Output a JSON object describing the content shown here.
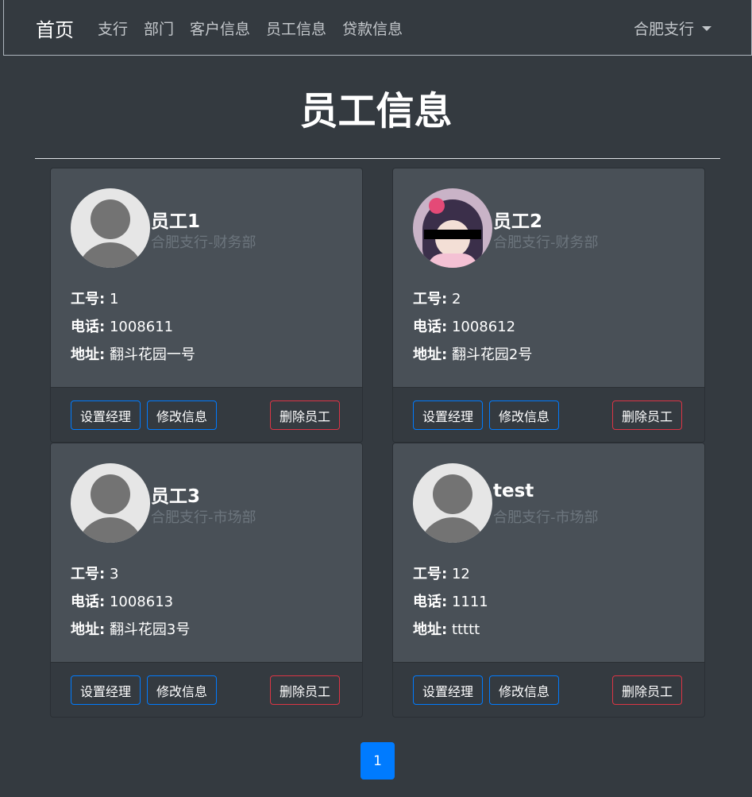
{
  "navbar": {
    "brand": "首页",
    "links": [
      "支行",
      "部门",
      "客户信息",
      "员工信息",
      "贷款信息"
    ],
    "branch_dropdown": "合肥支行"
  },
  "page_title": "员工信息",
  "labels": {
    "id": "工号:",
    "phone": "电话:",
    "address": "地址:"
  },
  "buttons": {
    "set_manager": "设置经理",
    "edit": "修改信息",
    "delete": "删除员工"
  },
  "employees": [
    {
      "name": "员工1",
      "dept": "合肥支行-财务部",
      "id": "1",
      "phone": "1008611",
      "address": "翻斗花园一号",
      "avatar": "default-avatar-icon"
    },
    {
      "name": "员工2",
      "dept": "合肥支行-财务部",
      "id": "2",
      "phone": "1008612",
      "address": "翻斗花园2号",
      "avatar": "anime-avatar-photo"
    },
    {
      "name": "员工3",
      "dept": "合肥支行-市场部",
      "id": "3",
      "phone": "1008613",
      "address": "翻斗花园3号",
      "avatar": "default-avatar-icon"
    },
    {
      "name": "test",
      "dept": "合肥支行-市场部",
      "id": "12",
      "phone": "1111",
      "address": "ttttt",
      "avatar": "default-avatar-icon"
    }
  ],
  "pagination": {
    "current_page": "1"
  },
  "colors": {
    "background": "#343a40",
    "card_body": "#495057",
    "primary": "#007bff",
    "danger": "#dc3545",
    "muted": "#6c757d"
  }
}
